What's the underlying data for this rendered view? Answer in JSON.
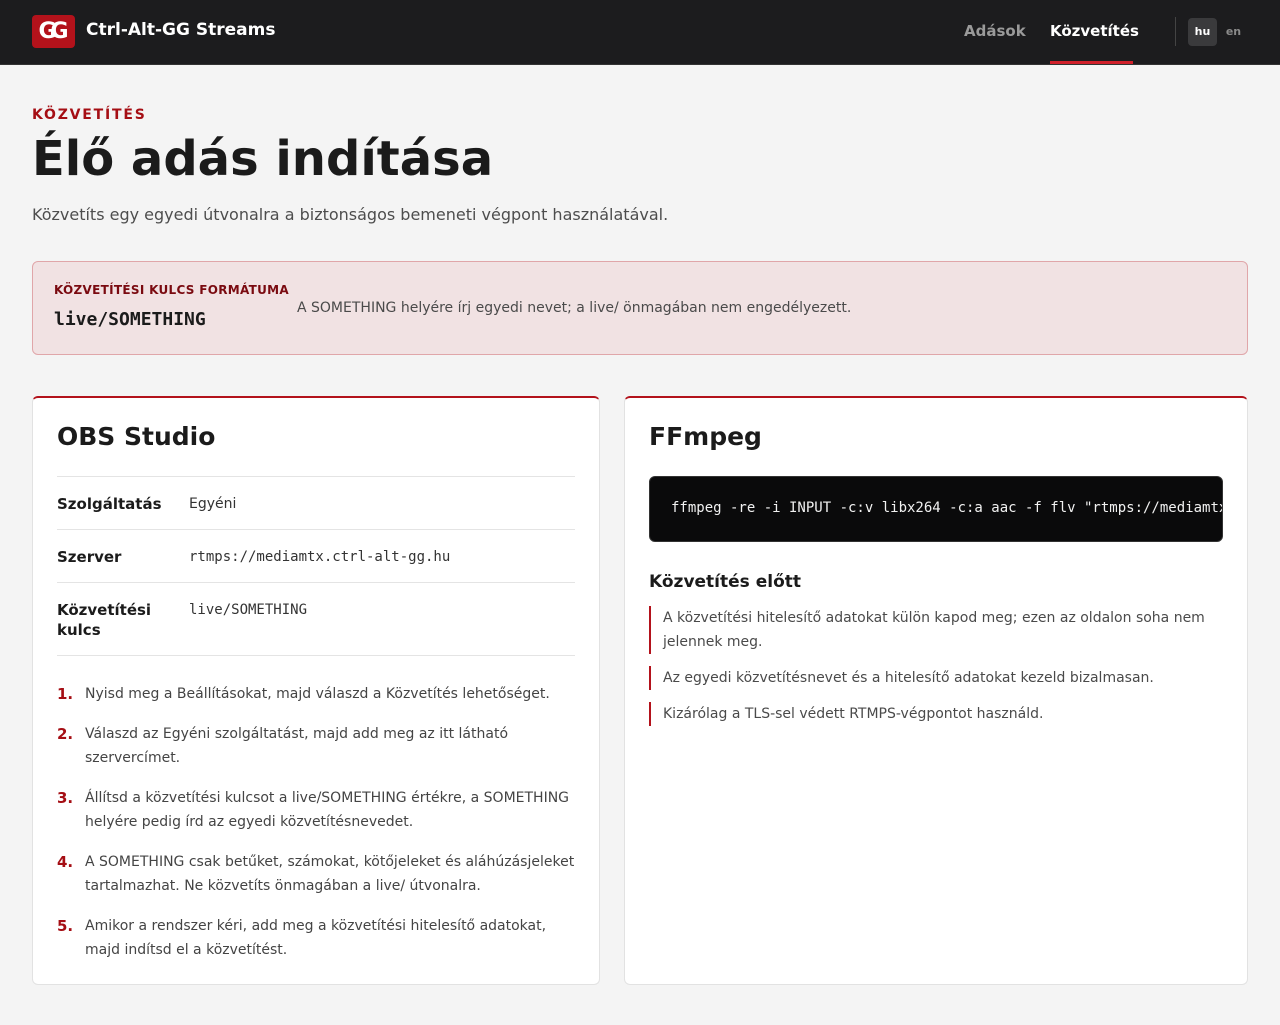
{
  "header": {
    "logo_text": "GG",
    "brand": "Ctrl-Alt-GG Streams",
    "nav": [
      {
        "label": "Adások",
        "active": false
      },
      {
        "label": "Közvetítés",
        "active": true
      }
    ],
    "languages": [
      {
        "label": "hu",
        "active": true
      },
      {
        "label": "en",
        "active": false
      }
    ]
  },
  "page": {
    "eyebrow": "KÖZVETÍTÉS",
    "title": "Élő adás indítása",
    "lede": "Közvetíts egy egyedi útvonalra a biztonságos bemeneti végpont használatával."
  },
  "format_box": {
    "label": "KÖZVETÍTÉSI KULCS FORMÁTUMA",
    "code": "live/SOMETHING",
    "note": "A SOMETHING helyére írj egyedi nevet; a live/ önmagában nem engedélyezett."
  },
  "obs": {
    "title": "OBS Studio",
    "rows": [
      {
        "label": "Szolgáltatás",
        "value": "Egyéni"
      },
      {
        "label": "Szerver",
        "value": "rtmps://mediamtx.ctrl-alt-gg.hu"
      },
      {
        "label": "Közvetítési kulcs",
        "value": "live/SOMETHING"
      }
    ],
    "steps": [
      {
        "num": "1.",
        "text": "Nyisd meg a Beállításokat, majd válaszd a Közvetítés lehetőséget."
      },
      {
        "num": "2.",
        "text": "Válaszd az Egyéni szolgáltatást, majd add meg az itt látható szervercímet."
      },
      {
        "num": "3.",
        "text": "Állítsd a közvetítési kulcsot a live/SOMETHING értékre, a SOMETHING helyére pedig írd az egyedi közvetítésnevedet."
      },
      {
        "num": "4.",
        "text": "A SOMETHING csak betűket, számokat, kötőjeleket és aláhúzásjeleket tartalmazhat. Ne közvetíts önmagában a live/ útvonalra."
      },
      {
        "num": "5.",
        "text": "Amikor a rendszer kéri, add meg a közvetítési hitelesítő adatokat, majd indítsd el a közvetítést."
      }
    ]
  },
  "ffmpeg": {
    "title": "FFmpeg",
    "command": "ffmpeg -re -i INPUT -c:v libx264 -c:a aac -f flv \"rtmps://mediamtx.ctrl-alt-gg.hu/live/SOMETHING\"",
    "before_title": "Közvetítés előtt",
    "notes": [
      "A közvetítési hitelesítő adatokat külön kapod meg; ezen az oldalon soha nem jelennek meg.",
      "Az egyedi közvetítésnevet és a hitelesítő adatokat kezeld bizalmasan.",
      "Kizárólag a TLS-sel védett RTMPS-végpontot használd."
    ]
  },
  "colors": {
    "accent": "#b3121b",
    "header_bg": "#1c1c1e",
    "format_bg": "#f1e2e3"
  }
}
